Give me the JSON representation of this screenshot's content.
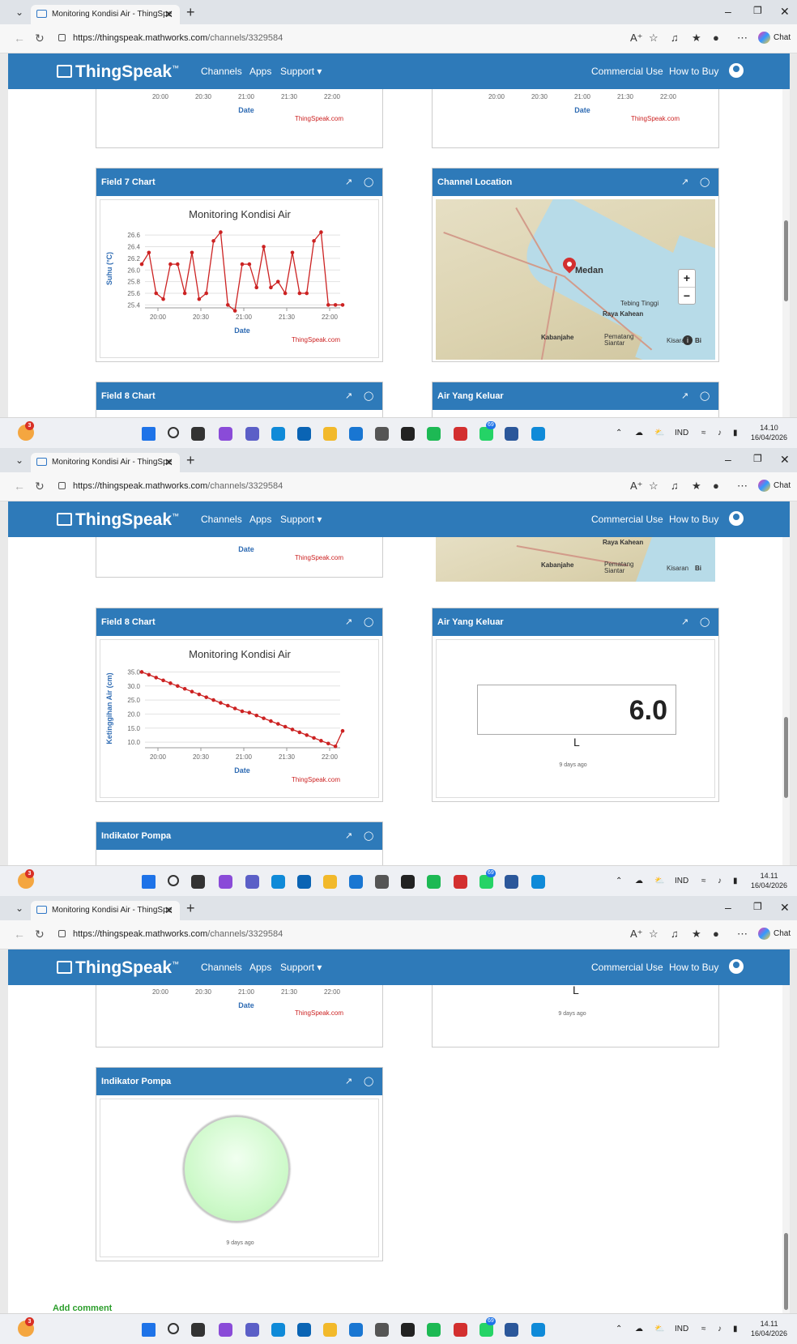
{
  "browser": {
    "tab_title": "Monitoring Kondisi Air - ThingSpe",
    "url_host": "https://thingspeak.mathworks.com",
    "url_path": "/channels/3329584",
    "chat_label": "Chat",
    "window_controls": [
      "–",
      "❐",
      "✕"
    ]
  },
  "header": {
    "logo": "ThingSpeak",
    "logo_tm": "™",
    "nav": [
      "Channels",
      "Apps",
      "Support"
    ],
    "right_nav": [
      "Commercial Use",
      "How to Buy"
    ]
  },
  "cards": {
    "field7": {
      "title": "Field 7 Chart"
    },
    "location": {
      "title": "Channel Location"
    },
    "field8": {
      "title": "Field 8 Chart"
    },
    "air": {
      "title": "Air Yang Keluar",
      "value": "6.0",
      "unit": "L",
      "updated": "9 days ago"
    },
    "pompa": {
      "title": "Indikator Pompa",
      "updated": "9 days ago",
      "state": "on"
    }
  },
  "map": {
    "cities": [
      "Medan",
      "Tebing Tinggi",
      "Raya Kahean",
      "Kabanjahe",
      "Pematang Siantar",
      "Kisaran",
      "Bi"
    ],
    "zoom_in": "+",
    "zoom_out": "−",
    "info_icon": "i"
  },
  "footer": {
    "add_comment": "Add comment"
  },
  "taskbar": {
    "weather_badge": "3",
    "whatsapp_badge": "69",
    "language": "IND",
    "times": [
      "14.10",
      "14.11",
      "14.11"
    ],
    "date": "16/04/2026",
    "icons": [
      "start-icon",
      "search-icon",
      "task-view-icon",
      "copilot-icon",
      "teams-icon",
      "edge-icon",
      "outlook-icon",
      "file-explorer-icon",
      "app-icon",
      "camera-icon",
      "media-icon",
      "spotify-icon",
      "wps-icon",
      "whatsapp-icon",
      "word-icon",
      "edge-beta-icon"
    ]
  },
  "chart_data": [
    {
      "type": "line",
      "title": "Monitoring Kondisi Air",
      "xlabel": "Date",
      "ylabel": "Suhu (°C)",
      "credit": "ThingSpeak.com",
      "x_ticks": [
        "20:00",
        "20:30",
        "21:00",
        "21:30",
        "22:00"
      ],
      "y_ticks": [
        "25.4",
        "25.6",
        "25.8",
        "26.0",
        "26.2",
        "26.4",
        "26.6"
      ],
      "ylim": [
        25.35,
        26.7
      ],
      "color": "#cc2222",
      "values": [
        26.1,
        26.3,
        25.6,
        25.5,
        26.1,
        26.1,
        25.6,
        26.3,
        25.5,
        25.6,
        26.5,
        26.65,
        25.4,
        25.3,
        26.1,
        26.1,
        25.7,
        26.4,
        25.7,
        25.8,
        25.6,
        26.3,
        25.6,
        25.6,
        26.5,
        26.65,
        25.4,
        25.4,
        25.4
      ]
    },
    {
      "type": "line",
      "title": "Monitoring Kondisi Air",
      "xlabel": "Date",
      "ylabel": "Ketinggihan Air (cm)",
      "credit": "ThingSpeak.com",
      "x_ticks": [
        "20:00",
        "20:30",
        "21:00",
        "21:30",
        "22:00"
      ],
      "y_ticks": [
        "10.0",
        "15.0",
        "20.0",
        "25.0",
        "30.0",
        "35.0"
      ],
      "ylim": [
        8,
        36
      ],
      "color": "#cc2222",
      "values": [
        35.0,
        34.0,
        33.0,
        32.0,
        31.0,
        30.0,
        29.0,
        28.0,
        27.0,
        26.0,
        25.0,
        24.0,
        23.0,
        22.0,
        21.0,
        20.5,
        19.5,
        18.5,
        17.5,
        16.5,
        15.5,
        14.5,
        13.5,
        12.5,
        11.5,
        10.5,
        9.5,
        8.5,
        14.0
      ]
    }
  ]
}
